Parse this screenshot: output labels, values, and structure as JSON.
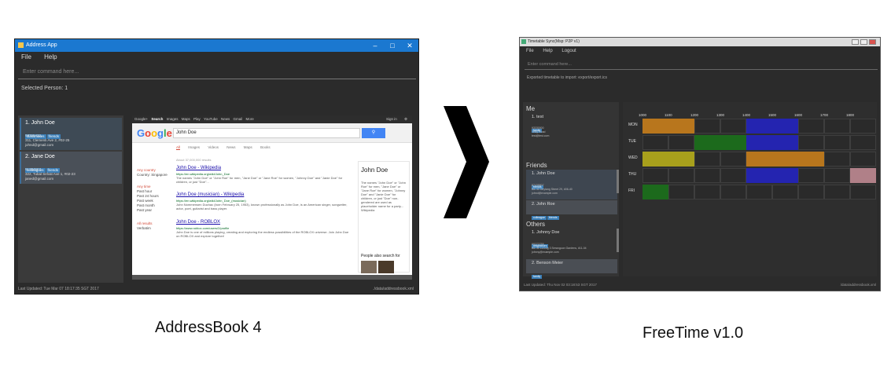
{
  "addressbook": {
    "title": "Address App",
    "menu": [
      "File",
      "Help"
    ],
    "command_placeholder": "Enter command here...",
    "result": "Selected Person: 1",
    "persons": [
      {
        "name": "1. John Doe",
        "tags": [
          "classmates",
          "friends"
        ],
        "lines": [
          "98765432",
          "311, Clementi Ave 2, #02-25",
          "johnd@gmail.com"
        ]
      },
      {
        "name": "2. Jane Doe",
        "tags": [
          "colleagues",
          "friends"
        ],
        "lines": [
          "91234567",
          "322, Tubal Selvat Ave 1, #02-23",
          "janed@gmail.com"
        ]
      }
    ],
    "browser": {
      "bar_items": [
        "Google+",
        "Search",
        "Images",
        "Maps",
        "Play",
        "YouTube",
        "News",
        "Gmail",
        "More"
      ],
      "sign_in": "Sign in",
      "logo": "Google",
      "query": "John Doe",
      "search_icon": "search-icon",
      "tabs": [
        "All",
        "Images",
        "Videos",
        "News",
        "Maps",
        "Books"
      ],
      "count": "About 37,000,000 results",
      "filters": [
        "Any country",
        "Country: Singapore",
        "Any time",
        "Past hour",
        "Past 24 hours",
        "Past week",
        "Past month",
        "Past year",
        "All results",
        "Verbatim"
      ],
      "results": [
        {
          "title": "John Doe - Wikipedia",
          "url": "https://en.wikipedia.org/wiki/John_Doe",
          "snippet": "The names \"John Doe\" or \"John Roe\" for men, \"Jane Doe\" or \"Jane Roe\" for women, \"Johnny Doe\" and \"Janie Doe\" for children, or just \"Doe\"..."
        },
        {
          "title": "John Doe (musician) - Wikipedia",
          "url": "https://en.wikipedia.org/wiki/John_Doe_(musician)",
          "snippet": "John Nommensen Duchac (born February 25, 1953), known professionally as John Doe, is an American singer, songwriter, actor, poet, guitarist and bass player."
        },
        {
          "title": "John Doe - ROBLOX",
          "url": "https://www.roblox.com/users/2/profile",
          "snippet": "John Doe is one of millions playing, creating and exploring the endless possibilities of the ROBLOX universe. Join John Doe on ROBLOX and explore together!"
        }
      ],
      "panel_title": "John Doe",
      "panel_text": "The names \"John Doe\" or \"John Roe\" for men, \"Jane Doe\" or \"Jane Roe\" for women, \"Johnny Doe\" and \"Janie Doe\" for children, or just \"Doe\" non-gendered are used as placeholder name for a party... Wikipedia",
      "panel_also": "People also search for"
    },
    "status_left": "Last Updated: Tue Mar 07 18:17:35 SGT 2017",
    "status_right": "./data/addressbook.xml",
    "caption": "AddressBook 4"
  },
  "freetime": {
    "title": "Timetable Sync(Msp: P2P v1)",
    "menu": [
      "File",
      "Help",
      "Logout"
    ],
    "command_placeholder": "Enter command here...",
    "result": "Exported timetable to import: export/export.ics",
    "me_header": "Me",
    "me": {
      "name": "1. test",
      "tags": [
        "family"
      ],
      "lines": [
        "93330000",
        "Testy Road",
        "test@test.com"
      ]
    },
    "friends_header": "Friends",
    "friends": [
      {
        "name": "1. John Doe",
        "tags": [
          "friends"
        ],
        "lines": [
          "87438807",
          "Blk 30 Geylang Street 29, #06-40",
          "johnd@example.com"
        ]
      },
      {
        "name": "2. John Roe",
        "tags": [
          "colleague",
          "friends"
        ],
        "lines": []
      }
    ],
    "others_header": "Others",
    "others": [
      {
        "name": "1. Johnny Doe",
        "tags": [
          "neighbours"
        ],
        "lines": [
          "99272758",
          "Blk 30 Lorong 3 Serangoon Gardens, #11-04",
          "johnny@example.com"
        ]
      },
      {
        "name": "2. Benson Meier",
        "tags": [
          "family"
        ],
        "lines": []
      }
    ],
    "hours": [
      "1000",
      "1100",
      "1200",
      "1300",
      "1400",
      "1500",
      "1600",
      "1700",
      "1800"
    ],
    "days": [
      "MON",
      "TUE",
      "WED",
      "THU",
      "FRI"
    ],
    "colors": {
      "orange": "#b8761d",
      "blue": "#2424b0",
      "green": "#1c6a1c",
      "olive": "#a8a01c",
      "pink": "#b08088"
    },
    "status_left": "Last Updated: Thu Nov 02 03:18:53 SGT 2017",
    "status_right": "/data/addressbook.xml",
    "caption": "FreeTime v1.0"
  }
}
